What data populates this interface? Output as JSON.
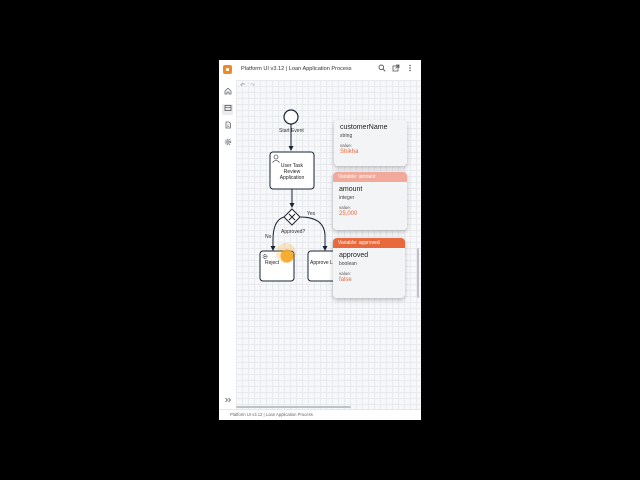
{
  "header": {
    "title": "Platform UI v3.12 | Loan Application Process"
  },
  "toolbar": {
    "undo_icon": "↶",
    "redo_icon": "↷"
  },
  "diagram": {
    "start_label": "Start Event",
    "task_lines": [
      "User Task",
      "Review",
      "Application"
    ],
    "gateway_label": "Approved?",
    "yes_label": "Yes",
    "no_label": "No",
    "reject_label": "Reject",
    "approve_label": "Approve L"
  },
  "variables": {
    "customer": {
      "name": "customerName",
      "type": "string",
      "value_label": "value:",
      "value": "Shikha"
    },
    "amount": {
      "header": "Variable: amount",
      "name": "amount",
      "type": "integer",
      "value_label": "value:",
      "value": "25,000"
    },
    "approved": {
      "header": "Variable: approved",
      "name": "approved",
      "type": "boolean",
      "value_label": "value:",
      "value": "false"
    }
  },
  "status": {
    "text": "Platform UI v3.12 | Loan Application Process"
  },
  "colors": {
    "accent": "#e8693b",
    "logo": "#f08a24",
    "cursor": "#f5a623"
  }
}
